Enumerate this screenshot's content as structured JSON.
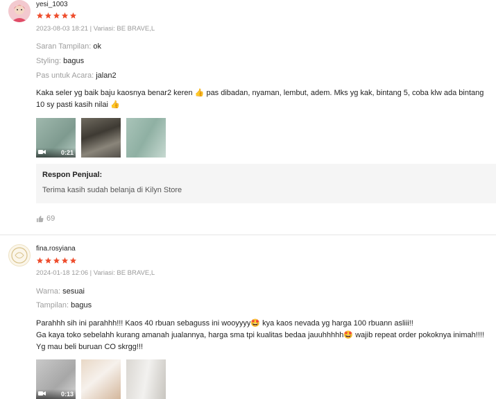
{
  "reviews": [
    {
      "username": "yesi_1003",
      "rating": 5,
      "meta": "2023-08-03 18:21 | Variasi: BE BRAVE,L",
      "attrs": [
        {
          "key": "Saran Tampilan:",
          "value": "ok"
        },
        {
          "key": "Styling:",
          "value": "bagus"
        },
        {
          "key": "Pas untuk Acara:",
          "value": "jalan2"
        }
      ],
      "text_line1": "Kaka seler yg baik baju kaosnya benar2 keren 👍 pas dibadan, nyaman, lembut, adem. Mks yg kak,  bintang 5, coba  klw ada bintang",
      "text_line2": "10 sy pasti kasih nilai 👍",
      "video_duration": "0:21",
      "seller_response_title": "Respon Penjual:",
      "seller_response_text": "Terima kasih sudah belanja di Kilyn Store",
      "likes": "69"
    },
    {
      "username": "fina.rosyiana",
      "rating": 5,
      "meta": "2024-01-18 12:06 | Variasi: BE BRAVE,L",
      "attrs": [
        {
          "key": "Warna:",
          "value": "sesuai"
        },
        {
          "key": "Tampilan:",
          "value": "bagus"
        }
      ],
      "text_line1": "Parahhh sih ini parahhh!!! Kaos 40 rbuan sebaguss ini wooyyyy🤩 kya kaos nevada yg harga 100 rbuann asliii!!",
      "text_line2": "Ga kaya toko sebelahh kurang amanah jualannya, harga sma tpi kualitas bedaa jauuhhhhh🤩 wajib repeat order pokoknya inimah!!!!",
      "text_line3": "Yg mau beli buruan CO skrgg!!!",
      "video_duration": "0:13"
    }
  ],
  "colors": {
    "star": "#ee4d2d",
    "muted": "#9a9a9a",
    "panel": "#f5f5f5"
  }
}
